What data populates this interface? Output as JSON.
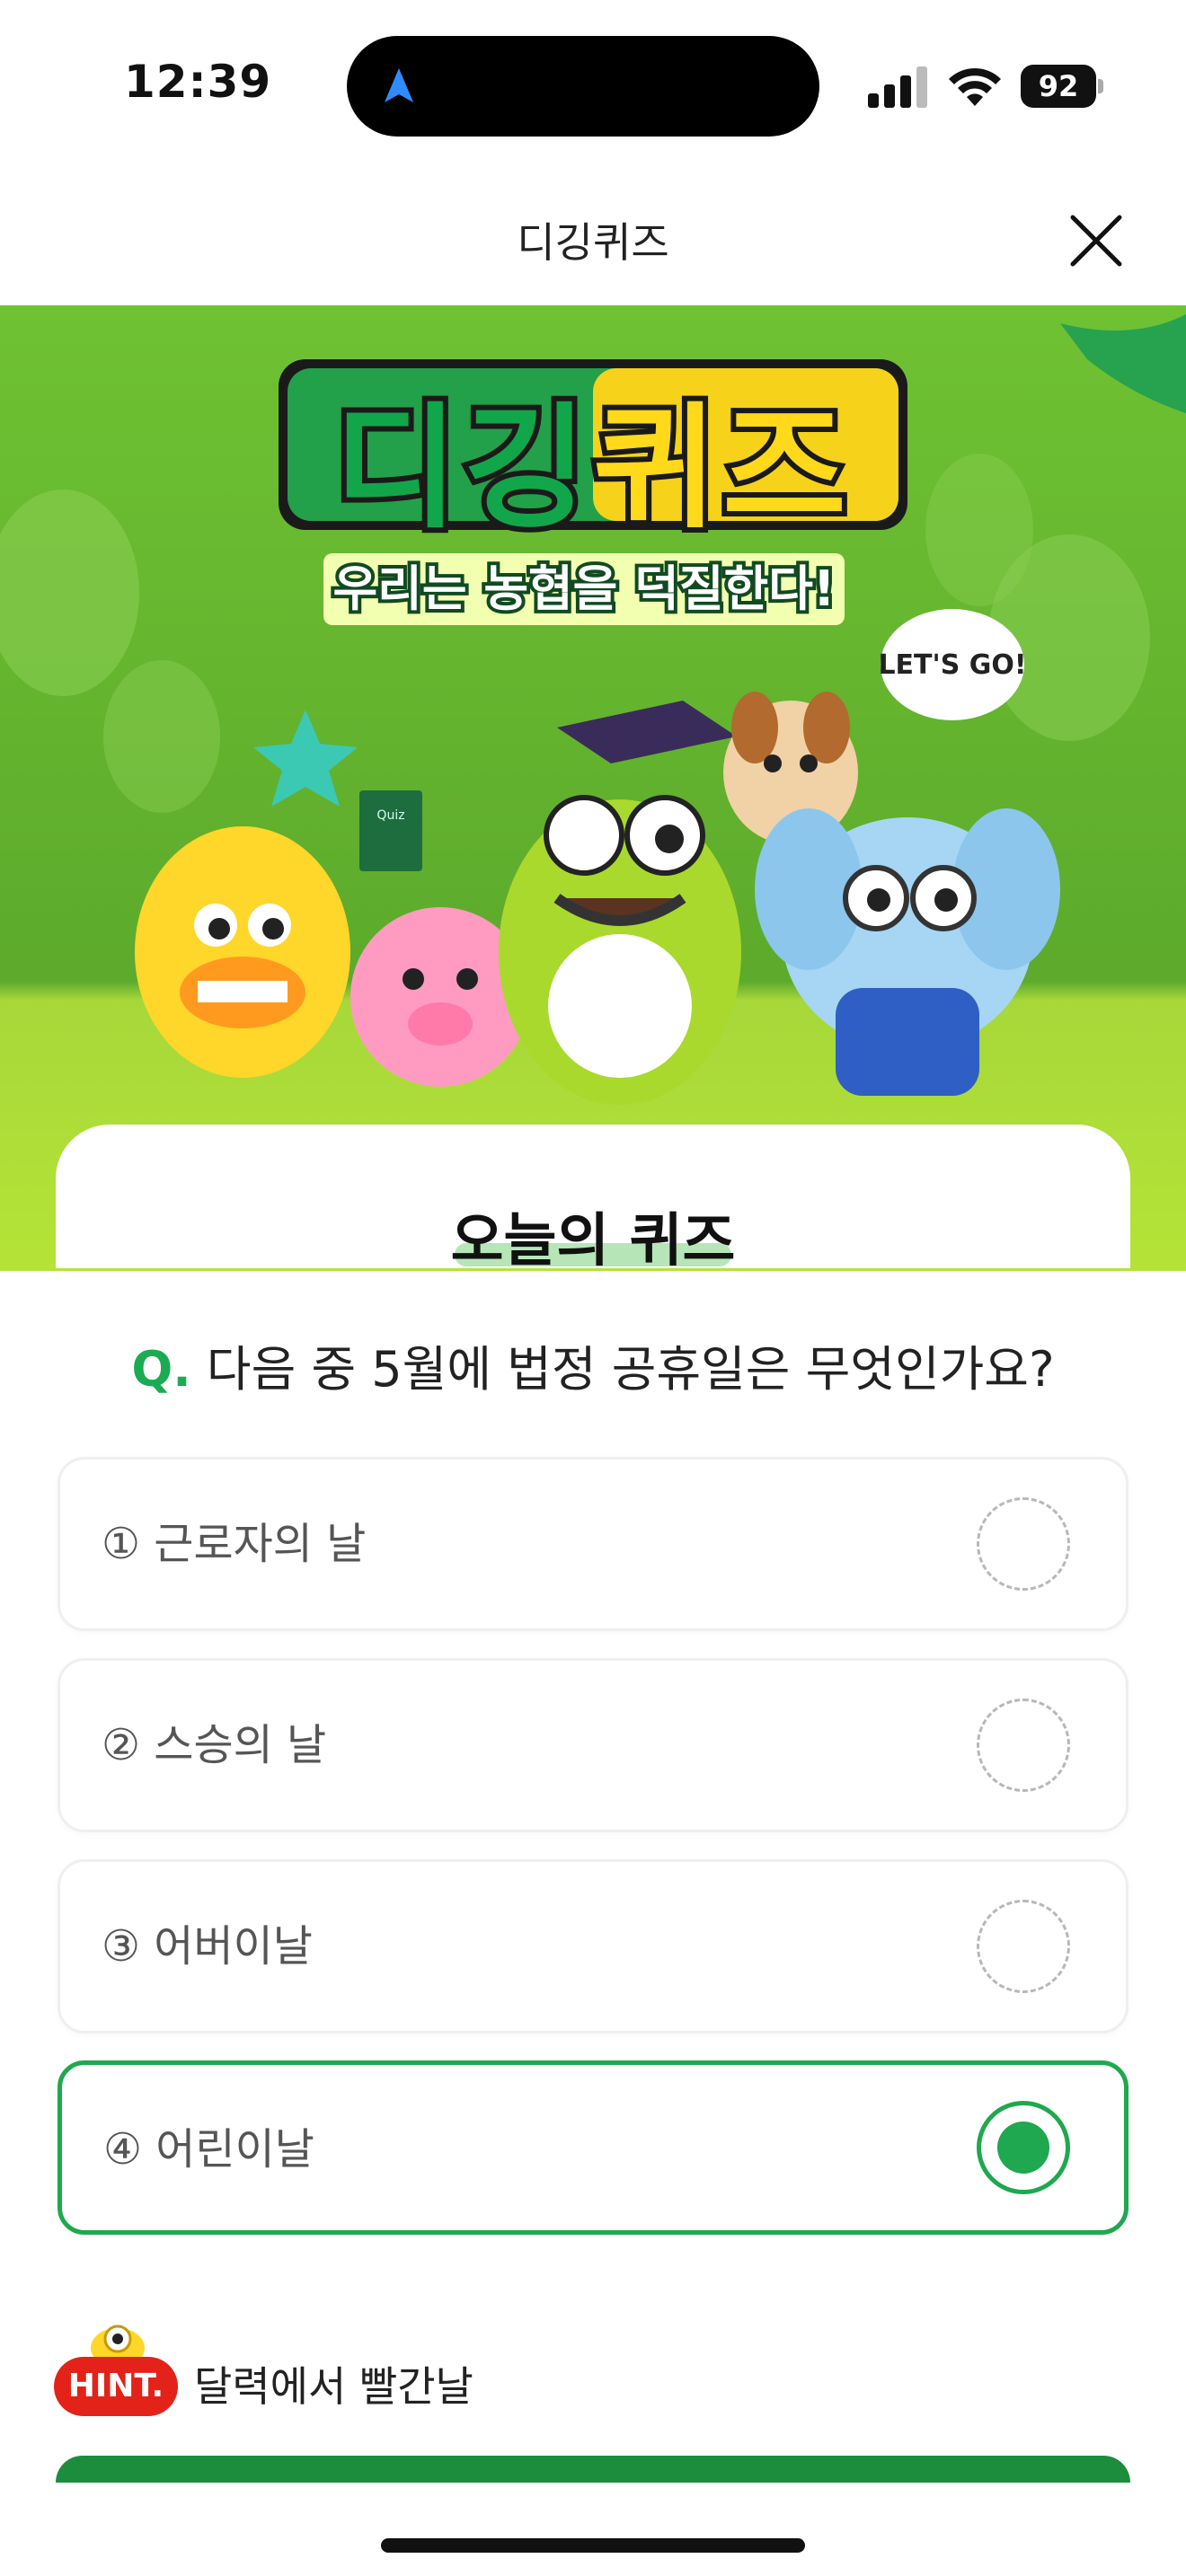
{
  "status_bar": {
    "time": "12:39",
    "battery": "92",
    "icons": [
      "navigation-arrow-icon",
      "cellular-signal-icon",
      "wifi-icon",
      "battery-icon"
    ]
  },
  "header": {
    "title": "디깅퀴즈",
    "close_icon": "close-icon"
  },
  "banner": {
    "title_part1": "디깅",
    "title_part2": "퀴즈",
    "subtitle": "우리는 농협을 덕질한다!",
    "speech_bubble": "LET'S GO!",
    "book_label": "Quiz"
  },
  "quiz": {
    "section_title": "오늘의 퀴즈",
    "question_prefix": "Q.",
    "question": "다음 중 5월에 법정 공휴일은 무엇인가요?",
    "options": [
      {
        "label": "① 근로자의 날",
        "selected": false
      },
      {
        "label": "② 스승의 날",
        "selected": false
      },
      {
        "label": "③ 어버이날",
        "selected": false
      },
      {
        "label": "④ 어린이날",
        "selected": true
      }
    ]
  },
  "hint": {
    "badge": "HINT.",
    "text": "달력에서 빨간날"
  },
  "colors": {
    "accent_green": "#1fa84f",
    "banner_green": "#72c234",
    "hint_red": "#e32219",
    "button_green": "#1b8d3c"
  }
}
